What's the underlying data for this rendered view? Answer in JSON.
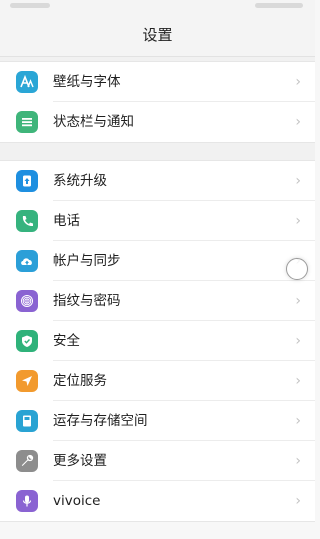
{
  "header": {
    "title": "设置"
  },
  "groups": [
    {
      "items": [
        {
          "label": "壁纸与字体",
          "icon": "wallpaper-font-icon",
          "color": "#2aa6d6"
        },
        {
          "label": "状态栏与通知",
          "icon": "notification-icon",
          "color": "#3fb57a"
        }
      ]
    },
    {
      "items": [
        {
          "label": "系统升级",
          "icon": "system-update-icon",
          "color": "#1e8fe0"
        },
        {
          "label": "电话",
          "icon": "phone-icon",
          "color": "#36b37e"
        },
        {
          "label": "帐户与同步",
          "icon": "cloud-sync-icon",
          "color": "#2b9fd8"
        },
        {
          "label": "指纹与密码",
          "icon": "fingerprint-icon",
          "color": "#8a63d2"
        },
        {
          "label": "安全",
          "icon": "shield-icon",
          "color": "#2fb27a"
        },
        {
          "label": "定位服务",
          "icon": "location-icon",
          "color": "#f29a2e"
        },
        {
          "label": "运存与存储空间",
          "icon": "storage-icon",
          "color": "#29a3d3"
        },
        {
          "label": "更多设置",
          "icon": "wrench-icon",
          "color": "#8d8d8d"
        },
        {
          "label": "vivoice",
          "icon": "microphone-icon",
          "color": "#8a63d2"
        }
      ]
    }
  ]
}
